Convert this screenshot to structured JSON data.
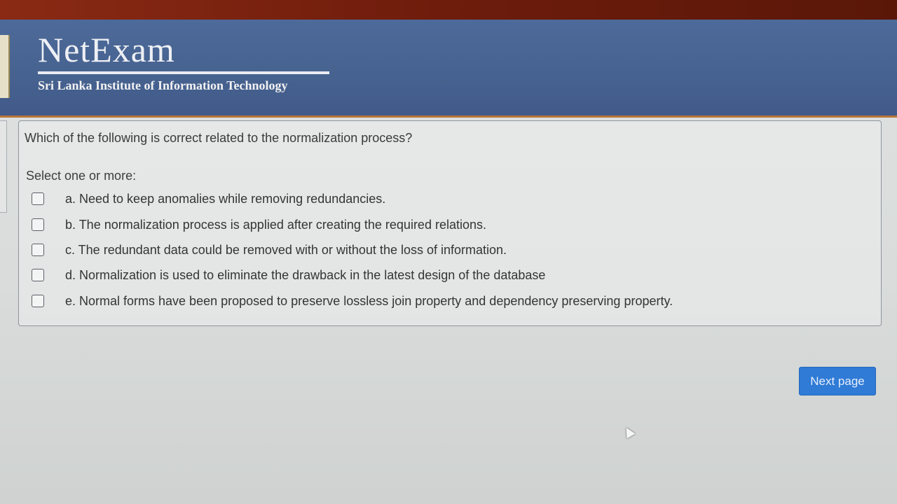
{
  "header": {
    "title": "NetExam",
    "subtitle": "Sri Lanka Institute of Information Technology"
  },
  "question": {
    "text": "Which of the following is correct related to the normalization process?",
    "prompt": "Select one or more:",
    "options": [
      {
        "label": "a. Need to keep anomalies while removing redundancies.",
        "checked": false
      },
      {
        "label": "b. The normalization process is applied after creating the required relations.",
        "checked": false
      },
      {
        "label": "c. The redundant data could be removed with or without the loss of information.",
        "checked": false
      },
      {
        "label": "d. Normalization is used to eliminate the drawback in the latest design of the database",
        "checked": false
      },
      {
        "label": "e. Normal forms have been proposed to preserve lossless join property and dependency preserving property.",
        "checked": false
      }
    ]
  },
  "navigation": {
    "next_label": "Next page"
  },
  "colors": {
    "header_bg": "#46628f",
    "accent_strip": "#7a2210",
    "button_bg": "#2f7bd6"
  }
}
